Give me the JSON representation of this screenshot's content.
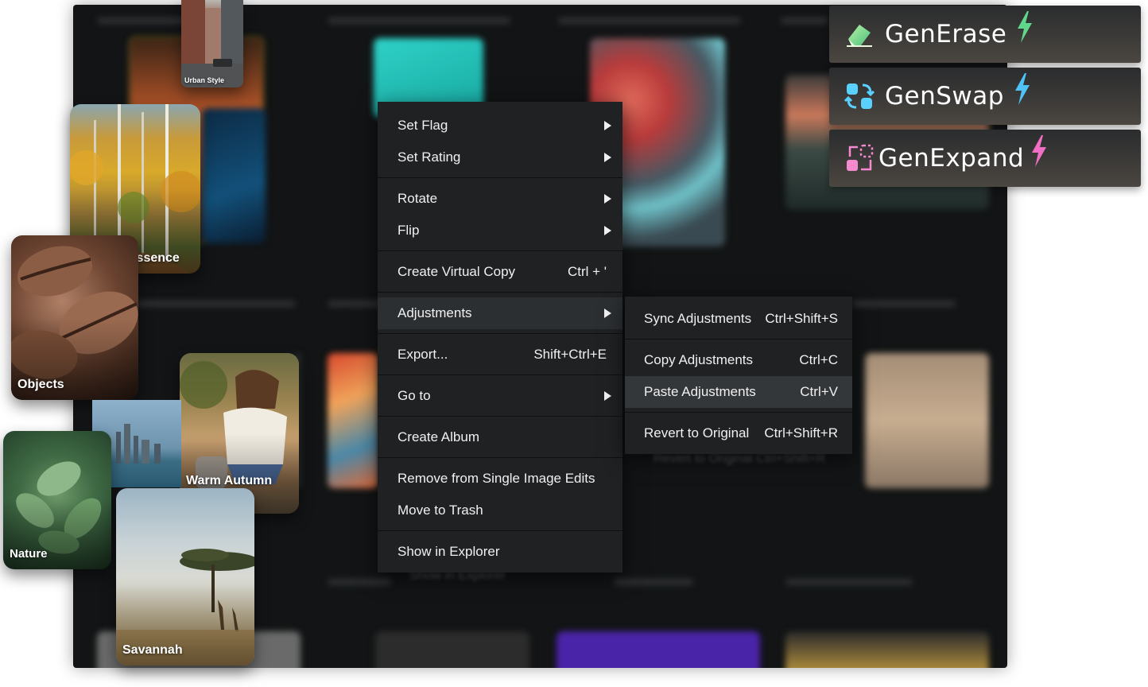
{
  "context_menu": {
    "items": [
      {
        "label": "Set Flag",
        "shortcut": "",
        "submenu": true
      },
      {
        "label": "Set Rating",
        "shortcut": "",
        "submenu": true
      },
      {
        "label": "Rotate",
        "shortcut": "",
        "submenu": true
      },
      {
        "label": "Flip",
        "shortcut": "",
        "submenu": true
      },
      {
        "label": "Create Virtual Copy",
        "shortcut": "Ctrl + '",
        "submenu": false
      },
      {
        "label": "Adjustments",
        "shortcut": "",
        "submenu": true,
        "highlighted": true
      },
      {
        "label": "Export...",
        "shortcut": "Shift+Ctrl+E",
        "submenu": false
      },
      {
        "label": "Go to",
        "shortcut": "",
        "submenu": true
      },
      {
        "label": "Create Album",
        "shortcut": "",
        "submenu": false
      },
      {
        "label": "Remove from Single Image Edits",
        "shortcut": "",
        "submenu": false
      },
      {
        "label": "Move to Trash",
        "shortcut": "",
        "submenu": false
      },
      {
        "label": "Show in Explorer",
        "shortcut": "",
        "submenu": false
      }
    ]
  },
  "adjustments_submenu": {
    "items": [
      {
        "label": "Sync Adjustments",
        "shortcut": "Ctrl+Shift+S"
      },
      {
        "label": "Copy Adjustments",
        "shortcut": "Ctrl+C"
      },
      {
        "label": "Paste Adjustments",
        "shortcut": "Ctrl+V",
        "highlighted": true
      },
      {
        "label": "Revert to Original",
        "shortcut": "Ctrl+Shift+R"
      }
    ]
  },
  "ghost": {
    "revert": "Revert to Original   Ctrl+Shift+R",
    "explorer": "Show in Explorer"
  },
  "features": [
    {
      "label": "GenErase",
      "icon": "eraser-icon",
      "bolt_color": "#5fd68a"
    },
    {
      "label": "GenSwap",
      "icon": "swap-icon",
      "bolt_color": "#4fc3f7"
    },
    {
      "label": "GenExpand",
      "icon": "expand-icon",
      "bolt_color": "#f06fc4"
    }
  ],
  "cards": [
    {
      "label": "Urban Style"
    },
    {
      "label": "Autumn Essence"
    },
    {
      "label": "Objects"
    },
    {
      "label": "Warm Autumn Vibes"
    },
    {
      "label": "Nature"
    },
    {
      "label": "Savannah"
    }
  ]
}
